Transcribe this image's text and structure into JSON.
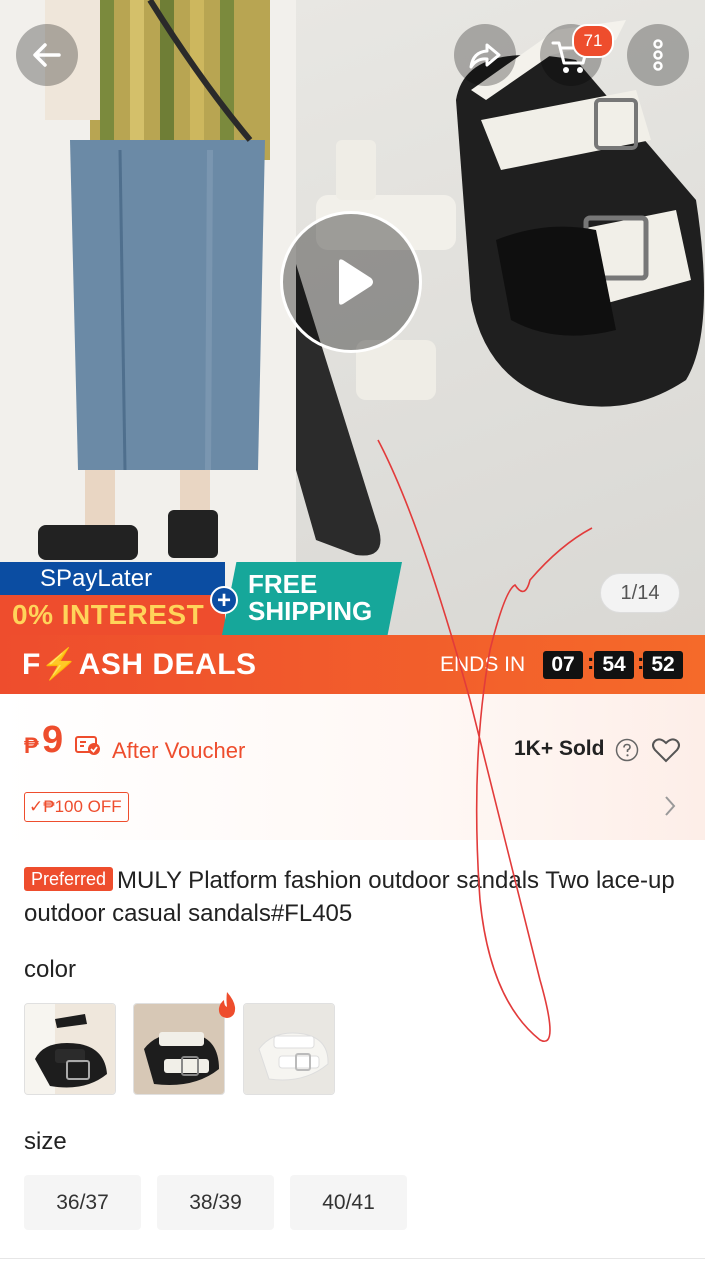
{
  "header": {
    "cart_count": "71",
    "image_counter": "1/14"
  },
  "promo": {
    "spaylater": "SPayLater",
    "interest": "0% INTEREST",
    "free_line1": "FREE",
    "free_line2": "SHIPPING"
  },
  "flash": {
    "title": "F⚡ASH DEALS",
    "ends_label": "ENDS IN",
    "hours": "07",
    "minutes": "54",
    "seconds": "52"
  },
  "price": {
    "currency": "₱",
    "value": "9",
    "after_voucher": "After Voucher",
    "sold": "1K+ Sold",
    "discount_tag": "✓₱100 OFF"
  },
  "product": {
    "badge": "Preferred",
    "title": "MULY Platform fashion outdoor sandals Two lace-up outdoor casual sandals#FL405"
  },
  "variations": {
    "color_label": "color",
    "size_label": "size",
    "sizes": [
      "36/37",
      "38/39",
      "40/41"
    ]
  },
  "colors": {
    "accent": "#ee4d2d",
    "spay_blue": "#0b4da2",
    "free_ship_teal": "#16a79a"
  }
}
